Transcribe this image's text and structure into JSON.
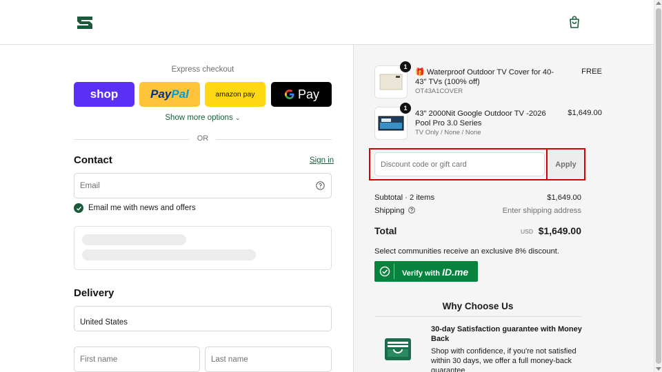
{
  "header": {
    "logo_icon": "brand-s-logo",
    "cart_icon": "shopping-bag-icon"
  },
  "express": {
    "title": "Express checkout",
    "shop_label": "shop",
    "paypal_label_1": "Pay",
    "paypal_label_2": "Pal",
    "amazon_label": "amazon pay",
    "gpay_label": "Pay",
    "show_more": "Show more options",
    "or": "OR"
  },
  "contact": {
    "title": "Contact",
    "signin": "Sign in",
    "email_placeholder": "Email",
    "newsletter_label": "Email me with news and offers",
    "newsletter_checked": true
  },
  "delivery": {
    "title": "Delivery",
    "country": "United States",
    "first_name_placeholder": "First name",
    "last_name_placeholder": "Last name"
  },
  "order": {
    "items": [
      {
        "qty": "1",
        "title": "🎁 Waterproof Outdoor TV Cover for 40-43\" TVs (100% off)",
        "sub": "OT43A1COVER",
        "price": "FREE"
      },
      {
        "qty": "1",
        "title": "43\" 2000Nit Google Outdoor TV -2026 Pool Pro 3.0 Series",
        "sub": "TV Only / None / None",
        "price": "$1,649.00"
      }
    ],
    "discount_placeholder": "Discount code or gift card",
    "apply": "Apply",
    "subtotal_label": "Subtotal · 2 items",
    "subtotal_value": "$1,649.00",
    "shipping_label": "Shipping",
    "shipping_value": "Enter shipping address",
    "total_label": "Total",
    "total_currency": "USD",
    "total_value": "$1,649.00",
    "community_text": "Select communities receive an exclusive 8% discount.",
    "verify_text": "Verify with",
    "verify_brand": "ID.me"
  },
  "why": {
    "title": "Why Choose Us",
    "head": "30-day Satisfaction guarantee with Money Back",
    "body": "Shop with confidence, if you're not satisfied within 30 days, we offer a full money-back guarantee"
  },
  "colors": {
    "brand_green": "#1a5a3a",
    "shop_purple": "#5a31f4",
    "paypal_yellow": "#ffc439",
    "amazon_yellow": "#ffd814",
    "idme_green": "#08833d",
    "highlight_red": "#d40000"
  }
}
